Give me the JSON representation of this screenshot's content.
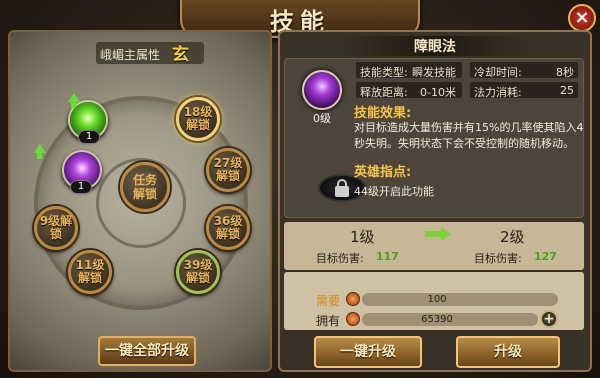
{
  "window": {
    "title": "技能",
    "close": "×"
  },
  "attribute": {
    "label": "峨嵋主属性",
    "value": "玄"
  },
  "skill_tree": {
    "nodes": [
      {
        "id": "node-18",
        "text": "18级\n解锁"
      },
      {
        "id": "node-27",
        "text": "27级\n解锁"
      },
      {
        "id": "node-36",
        "text": "36级\n解锁"
      },
      {
        "id": "node-39",
        "text": "39级\n解锁"
      },
      {
        "id": "node-11",
        "text": "11级\n解锁"
      },
      {
        "id": "node-9",
        "text": "9级解\n锁"
      }
    ],
    "center": "任务\n解锁",
    "owned": [
      {
        "name": "green-skill",
        "level": "1"
      },
      {
        "name": "purple-skill",
        "level": "1"
      }
    ]
  },
  "buttons": {
    "upgrade_all": "一键全部升级",
    "upgrade_once": "一键升级",
    "upgrade": "升级",
    "plus": "+"
  },
  "skill": {
    "name": "障眼法",
    "level": "0级",
    "type_label": "技能类型:",
    "type_value": "瞬发技能",
    "cooldown_label": "冷却时间:",
    "cooldown_value": "8秒",
    "range_label": "释放距离:",
    "range_value": "0-10米",
    "cost_label": "法力消耗:",
    "cost_value": "25",
    "effect_heading": "技能效果:",
    "effect_text": "对目标造成大量伤害并有15%的几率使其陷入4秒失明。失明状态下会不受控制的随机移动。",
    "hero_heading": "英雄指点:",
    "hero_text": "44级开启此功能"
  },
  "upgrade": {
    "from_level": "1级",
    "to_level": "2级",
    "dmg_label_from": "目标伤害:",
    "dmg_from": "117",
    "dmg_label_to": "目标伤害:",
    "dmg_to": "127"
  },
  "cost": {
    "need_label": "需要",
    "need_value": "100",
    "have_label": "拥有",
    "have_value": "65390"
  }
}
